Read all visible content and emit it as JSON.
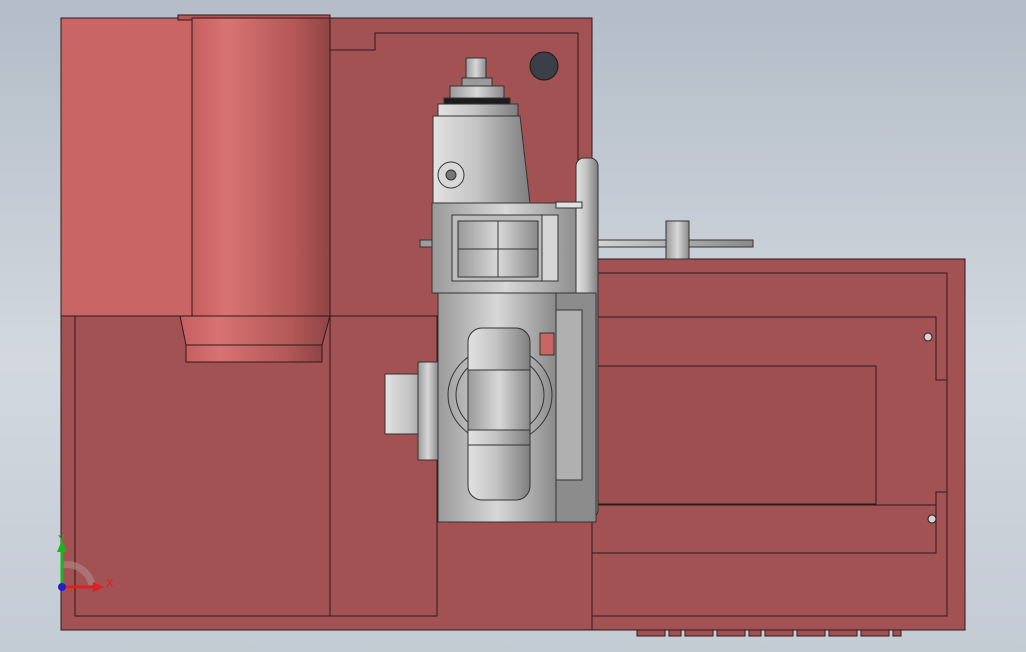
{
  "viewport": {
    "background_top": "#b3bcc7",
    "background_bottom": "#d2d8df"
  },
  "colors": {
    "body_red": "#a25252",
    "body_red_light": "#c96565",
    "cylinder_red": "#d07070",
    "steel": "#a8a8a8",
    "steel_light": "#d6d6d6",
    "steel_dark": "#7a7a7a",
    "edge": "#2e1a1a"
  },
  "triad": {
    "x_label": "X",
    "y_label": "Y",
    "x_color": "#e02020",
    "y_color": "#20b020",
    "origin_color": "#2020d0"
  }
}
